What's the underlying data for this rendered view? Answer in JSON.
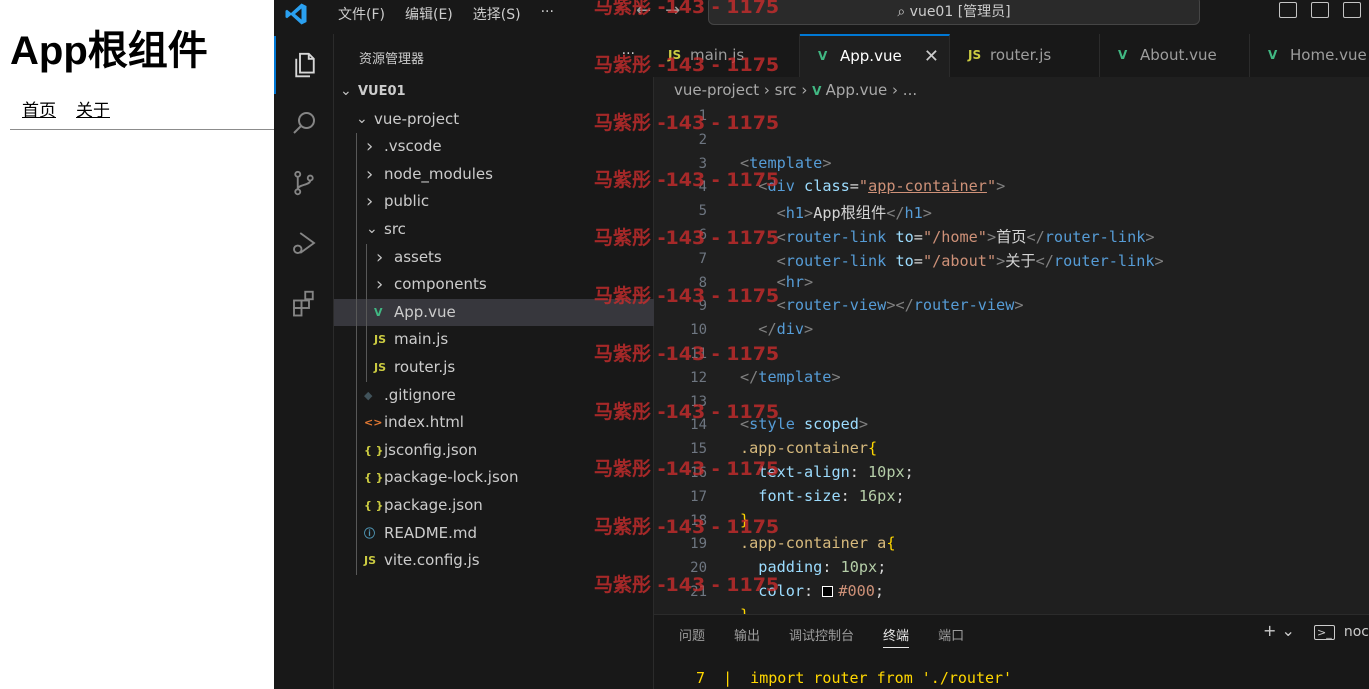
{
  "preview": {
    "heading": "App根组件",
    "links": [
      "首页",
      "关于"
    ]
  },
  "titlebar": {
    "menu": [
      "文件(F)",
      "编辑(E)",
      "选择(S)",
      "···"
    ],
    "command_center": "vue01 [管理员]"
  },
  "sidebar": {
    "title": "资源管理器",
    "more": "···",
    "root": "VUE01",
    "tree": [
      {
        "label": "vue-project",
        "type": "folder-open",
        "depth": 1
      },
      {
        "label": ".vscode",
        "type": "folder",
        "depth": 2
      },
      {
        "label": "node_modules",
        "type": "folder",
        "depth": 2
      },
      {
        "label": "public",
        "type": "folder",
        "depth": 2
      },
      {
        "label": "src",
        "type": "folder-open",
        "depth": 2
      },
      {
        "label": "assets",
        "type": "folder",
        "depth": 3
      },
      {
        "label": "components",
        "type": "folder",
        "depth": 3
      },
      {
        "label": "App.vue",
        "type": "vue",
        "depth": 3,
        "selected": true
      },
      {
        "label": "main.js",
        "type": "js",
        "depth": 3
      },
      {
        "label": "router.js",
        "type": "js",
        "depth": 3
      },
      {
        "label": ".gitignore",
        "type": "git",
        "depth": 2
      },
      {
        "label": "index.html",
        "type": "html",
        "depth": 2
      },
      {
        "label": "jsconfig.json",
        "type": "json",
        "depth": 2
      },
      {
        "label": "package-lock.json",
        "type": "json",
        "depth": 2
      },
      {
        "label": "package.json",
        "type": "json",
        "depth": 2
      },
      {
        "label": "README.md",
        "type": "info",
        "depth": 2
      },
      {
        "label": "vite.config.js",
        "type": "js",
        "depth": 2
      }
    ]
  },
  "tabs": [
    {
      "label": "main.js",
      "type": "js"
    },
    {
      "label": "App.vue",
      "type": "vue",
      "active": true
    },
    {
      "label": "router.js",
      "type": "js"
    },
    {
      "label": "About.vue",
      "type": "vue"
    },
    {
      "label": "Home.vue",
      "type": "vue"
    }
  ],
  "breadcrumb": {
    "parts": [
      "vue-project",
      "src",
      "App.vue",
      "..."
    ],
    "separator": "›"
  },
  "code": [
    {
      "n": "1",
      "tokens": []
    },
    {
      "n": "2",
      "tokens": []
    },
    {
      "n": "3",
      "tokens": [
        [
          "punc",
          "<"
        ],
        [
          "tag",
          "template"
        ],
        [
          "punc",
          ">"
        ]
      ]
    },
    {
      "n": "4",
      "tokens": [
        [
          "text",
          "  "
        ],
        [
          "punc",
          "<"
        ],
        [
          "tag",
          "div"
        ],
        [
          "text",
          " "
        ],
        [
          "attr",
          "class"
        ],
        [
          "text",
          "="
        ],
        [
          "str",
          "\""
        ],
        [
          "strU",
          "app-container"
        ],
        [
          "str",
          "\""
        ],
        [
          "punc",
          ">"
        ]
      ]
    },
    {
      "n": "5",
      "tokens": [
        [
          "text",
          "    "
        ],
        [
          "punc",
          "<"
        ],
        [
          "tag",
          "h1"
        ],
        [
          "punc",
          ">"
        ],
        [
          "text",
          "App根组件"
        ],
        [
          "punc",
          "</"
        ],
        [
          "tag",
          "h1"
        ],
        [
          "punc",
          ">"
        ]
      ]
    },
    {
      "n": "6",
      "tokens": [
        [
          "text",
          "    "
        ],
        [
          "punc",
          "<"
        ],
        [
          "tag",
          "router-link"
        ],
        [
          "text",
          " "
        ],
        [
          "attr",
          "to"
        ],
        [
          "text",
          "="
        ],
        [
          "str",
          "\"/home\""
        ],
        [
          "punc",
          ">"
        ],
        [
          "text",
          "首页"
        ],
        [
          "punc",
          "</"
        ],
        [
          "tag",
          "router-link"
        ],
        [
          "punc",
          ">"
        ]
      ]
    },
    {
      "n": "7",
      "tokens": [
        [
          "text",
          "    "
        ],
        [
          "punc",
          "<"
        ],
        [
          "tag",
          "router-link"
        ],
        [
          "text",
          " "
        ],
        [
          "attr",
          "to"
        ],
        [
          "text",
          "="
        ],
        [
          "str",
          "\"/about\""
        ],
        [
          "punc",
          ">"
        ],
        [
          "text",
          "关于"
        ],
        [
          "punc",
          "</"
        ],
        [
          "tag",
          "router-link"
        ],
        [
          "punc",
          ">"
        ]
      ]
    },
    {
      "n": "8",
      "tokens": [
        [
          "text",
          "    "
        ],
        [
          "punc",
          "<"
        ],
        [
          "tag",
          "hr"
        ],
        [
          "punc",
          ">"
        ]
      ]
    },
    {
      "n": "9",
      "tokens": [
        [
          "text",
          "    "
        ],
        [
          "punc",
          "<"
        ],
        [
          "tag",
          "router-view"
        ],
        [
          "punc",
          "></"
        ],
        [
          "tag",
          "router-view"
        ],
        [
          "punc",
          ">"
        ]
      ]
    },
    {
      "n": "10",
      "tokens": [
        [
          "text",
          "  "
        ],
        [
          "punc",
          "</"
        ],
        [
          "tag",
          "div"
        ],
        [
          "punc",
          ">"
        ]
      ]
    },
    {
      "n": "11",
      "tokens": []
    },
    {
      "n": "12",
      "tokens": [
        [
          "punc",
          "</"
        ],
        [
          "tag",
          "template"
        ],
        [
          "punc",
          ">"
        ]
      ]
    },
    {
      "n": "13",
      "tokens": []
    },
    {
      "n": "14",
      "tokens": [
        [
          "punc",
          "<"
        ],
        [
          "tag",
          "style"
        ],
        [
          "text",
          " "
        ],
        [
          "attr",
          "scoped"
        ],
        [
          "punc",
          ">"
        ]
      ]
    },
    {
      "n": "15",
      "tokens": [
        [
          "sel",
          ".app-container"
        ],
        [
          "brace",
          "{"
        ]
      ]
    },
    {
      "n": "16",
      "tokens": [
        [
          "text",
          "  "
        ],
        [
          "prop",
          "text-align"
        ],
        [
          "text",
          ": "
        ],
        [
          "num",
          "10px"
        ],
        [
          "text",
          ";"
        ]
      ]
    },
    {
      "n": "17",
      "tokens": [
        [
          "text",
          "  "
        ],
        [
          "prop",
          "font-size"
        ],
        [
          "text",
          ": "
        ],
        [
          "num",
          "16px"
        ],
        [
          "text",
          ";"
        ]
      ]
    },
    {
      "n": "18",
      "tokens": [
        [
          "brace",
          "}"
        ]
      ]
    },
    {
      "n": "19",
      "tokens": [
        [
          "sel",
          ".app-container a"
        ],
        [
          "brace",
          "{"
        ]
      ]
    },
    {
      "n": "20",
      "tokens": [
        [
          "text",
          "  "
        ],
        [
          "prop",
          "padding"
        ],
        [
          "text",
          ": "
        ],
        [
          "num",
          "10px"
        ],
        [
          "text",
          ";"
        ]
      ]
    },
    {
      "n": "21",
      "tokens": [
        [
          "text",
          "  "
        ],
        [
          "prop",
          "color"
        ],
        [
          "text",
          ": "
        ],
        [
          "swatch",
          ""
        ],
        [
          "str",
          "#000"
        ],
        [
          "text",
          ";"
        ]
      ]
    },
    {
      "n": "",
      "tokens": [
        [
          "brace",
          "}"
        ]
      ]
    }
  ],
  "panel": {
    "tabs": [
      "问题",
      "输出",
      "调试控制台",
      "终端",
      "端口"
    ],
    "active_tab": "终端",
    "actions": "+ ⌄",
    "terminal_label": "noc",
    "terminal_line": "7  |  import router from './router'"
  },
  "watermark": "马紫彤 -143 - 1175",
  "colors": {
    "accent": "#0078d4",
    "vue": "#41b883",
    "js": "#cbcb41",
    "json": "#cbcb41",
    "html": "#e37933",
    "watermark": "#cd2d2d"
  }
}
